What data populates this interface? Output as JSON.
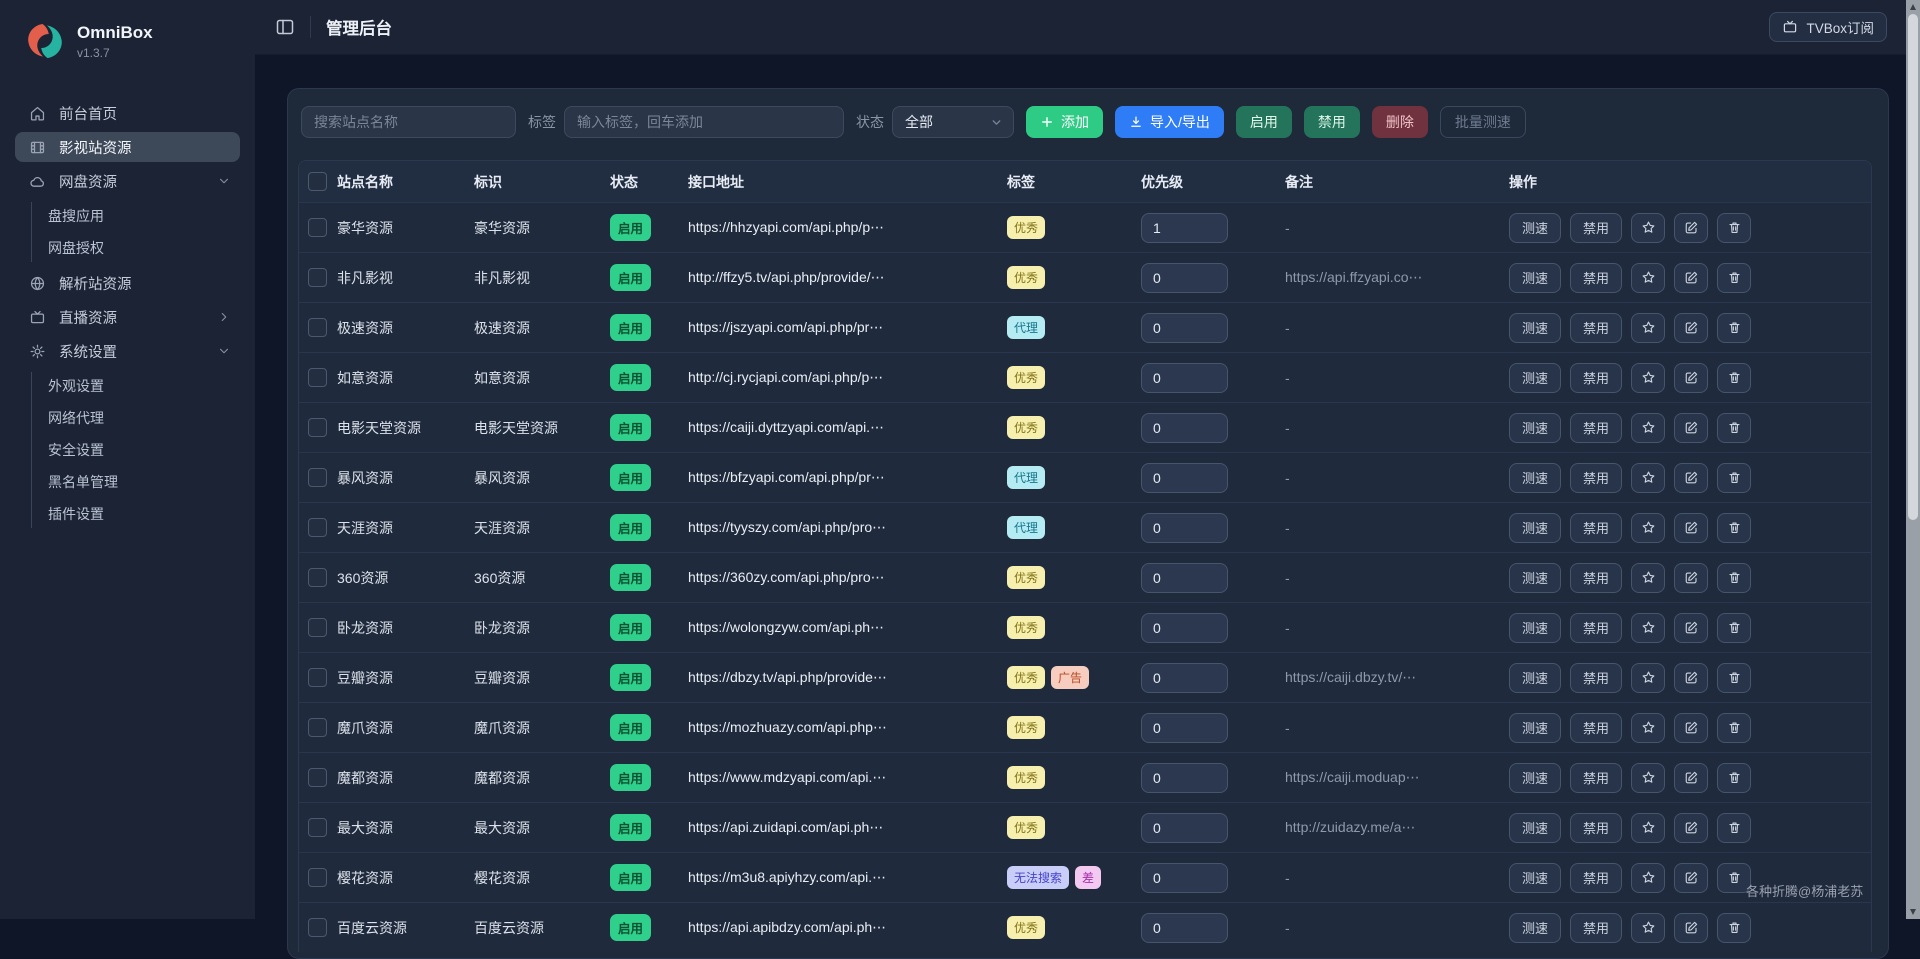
{
  "app": {
    "name": "OmniBox",
    "version": "v1.3.7"
  },
  "topbar": {
    "title": "管理后台",
    "tvbox_button": "TVBox订阅"
  },
  "sidebar": {
    "items": [
      {
        "label": "前台首页",
        "icon": "home-icon",
        "active": false
      },
      {
        "label": "影视站资源",
        "icon": "film-icon",
        "active": true
      },
      {
        "label": "网盘资源",
        "icon": "cloud-icon",
        "active": false,
        "chevron": "down",
        "children": [
          "盘搜应用",
          "网盘授权"
        ]
      },
      {
        "label": "解析站资源",
        "icon": "globe-icon",
        "active": false
      },
      {
        "label": "直播资源",
        "icon": "tv-icon",
        "active": false,
        "chevron": "right"
      },
      {
        "label": "系统设置",
        "icon": "gear-icon",
        "active": false,
        "chevron": "down",
        "children": [
          "外观设置",
          "网络代理",
          "安全设置",
          "黑名单管理",
          "插件设置"
        ]
      }
    ]
  },
  "toolbar": {
    "search_placeholder": "搜索站点名称",
    "tag_label": "标签",
    "tag_placeholder": "输入标签，回车添加",
    "status_label": "状态",
    "status_value": "全部",
    "add_label": "添加",
    "import_export_label": "导入/导出",
    "enable_label": "启用",
    "disable_label": "禁用",
    "delete_label": "删除",
    "batch_speed_label": "批量测速"
  },
  "table": {
    "headers": [
      "站点名称",
      "标识",
      "状态",
      "接口地址",
      "标签",
      "优先级",
      "备注",
      "操作"
    ],
    "row_actions": {
      "speed": "测速",
      "disable": "禁用"
    },
    "rows": [
      {
        "name": "豪华资源",
        "ident": "豪华资源",
        "status": "启用",
        "api": "https://hhzyapi.com/api.php/p⋯",
        "tags": [
          {
            "text": "优秀",
            "variant": "excellent"
          }
        ],
        "priority": "1",
        "remark": "-"
      },
      {
        "name": "非凡影视",
        "ident": "非凡影视",
        "status": "启用",
        "api": "http://ffzy5.tv/api.php/provide/⋯",
        "tags": [
          {
            "text": "优秀",
            "variant": "excellent"
          }
        ],
        "priority": "0",
        "remark": "https://api.ffzyapi.co⋯"
      },
      {
        "name": "极速资源",
        "ident": "极速资源",
        "status": "启用",
        "api": "https://jszyapi.com/api.php/pr⋯",
        "tags": [
          {
            "text": "代理",
            "variant": "proxy"
          }
        ],
        "priority": "0",
        "remark": "-"
      },
      {
        "name": "如意资源",
        "ident": "如意资源",
        "status": "启用",
        "api": "http://cj.rycjapi.com/api.php/p⋯",
        "tags": [
          {
            "text": "优秀",
            "variant": "excellent"
          }
        ],
        "priority": "0",
        "remark": "-"
      },
      {
        "name": "电影天堂资源",
        "ident": "电影天堂资源",
        "status": "启用",
        "api": "https://caiji.dyttzyapi.com/api.⋯",
        "tags": [
          {
            "text": "优秀",
            "variant": "excellent"
          }
        ],
        "priority": "0",
        "remark": "-"
      },
      {
        "name": "暴风资源",
        "ident": "暴风资源",
        "status": "启用",
        "api": "https://bfzyapi.com/api.php/pr⋯",
        "tags": [
          {
            "text": "代理",
            "variant": "proxy"
          }
        ],
        "priority": "0",
        "remark": "-"
      },
      {
        "name": "天涯资源",
        "ident": "天涯资源",
        "status": "启用",
        "api": "https://tyyszy.com/api.php/pro⋯",
        "tags": [
          {
            "text": "代理",
            "variant": "proxy"
          }
        ],
        "priority": "0",
        "remark": "-"
      },
      {
        "name": "360资源",
        "ident": "360资源",
        "status": "启用",
        "api": "https://360zy.com/api.php/pro⋯",
        "tags": [
          {
            "text": "优秀",
            "variant": "excellent"
          }
        ],
        "priority": "0",
        "remark": "-"
      },
      {
        "name": "卧龙资源",
        "ident": "卧龙资源",
        "status": "启用",
        "api": "https://wolongzyw.com/api.ph⋯",
        "tags": [
          {
            "text": "优秀",
            "variant": "excellent"
          }
        ],
        "priority": "0",
        "remark": "-"
      },
      {
        "name": "豆瓣资源",
        "ident": "豆瓣资源",
        "status": "启用",
        "api": "https://dbzy.tv/api.php/provide⋯",
        "tags": [
          {
            "text": "优秀",
            "variant": "excellent"
          },
          {
            "text": "广告",
            "variant": "ad"
          }
        ],
        "priority": "0",
        "remark": "https://caiji.dbzy.tv/⋯"
      },
      {
        "name": "魔爪资源",
        "ident": "魔爪资源",
        "status": "启用",
        "api": "https://mozhuazy.com/api.php⋯",
        "tags": [
          {
            "text": "优秀",
            "variant": "excellent"
          }
        ],
        "priority": "0",
        "remark": "-"
      },
      {
        "name": "魔都资源",
        "ident": "魔都资源",
        "status": "启用",
        "api": "https://www.mdzyapi.com/api.⋯",
        "tags": [
          {
            "text": "优秀",
            "variant": "excellent"
          }
        ],
        "priority": "0",
        "remark": "https://caiji.moduap⋯"
      },
      {
        "name": "最大资源",
        "ident": "最大资源",
        "status": "启用",
        "api": "https://api.zuidapi.com/api.ph⋯",
        "tags": [
          {
            "text": "优秀",
            "variant": "excellent"
          }
        ],
        "priority": "0",
        "remark": "http://zuidazy.me/a⋯"
      },
      {
        "name": "樱花资源",
        "ident": "樱花资源",
        "status": "启用",
        "api": "https://m3u8.apiyhzy.com/api.⋯",
        "tags": [
          {
            "text": "无法搜索",
            "variant": "nosearch"
          },
          {
            "text": "差",
            "variant": "poor"
          }
        ],
        "priority": "0",
        "remark": "-"
      },
      {
        "name": "百度云资源",
        "ident": "百度云资源",
        "status": "启用",
        "api": "https://api.apibdzy.com/api.ph⋯",
        "tags": [
          {
            "text": "优秀",
            "variant": "excellent"
          }
        ],
        "priority": "0",
        "remark": "-"
      }
    ]
  },
  "watermark": "各种折腾@杨浦老苏",
  "colors": {
    "sidebar_bg": "#1b2334",
    "content_bg": "#0f1628",
    "card_bg": "#1e2939",
    "accent_add_green": "#2ecb85",
    "accent_import_blue": "#2e7cf6",
    "enable_disable_btn": "#23745a",
    "delete_btn": "#6f323e",
    "status_badge_bg": "#2fd08c",
    "status_badge_text": "#0d5132",
    "tag_excellent_bg": "#f6efad",
    "tag_proxy_bg": "#b5ecf4",
    "tag_ad_bg": "#f6cdbf",
    "tag_nosearch_bg": "#c9cef9",
    "tag_poor_bg": "#f3c8f1",
    "logo_orange": "#e45f4b",
    "logo_teal": "#27b3a2"
  }
}
